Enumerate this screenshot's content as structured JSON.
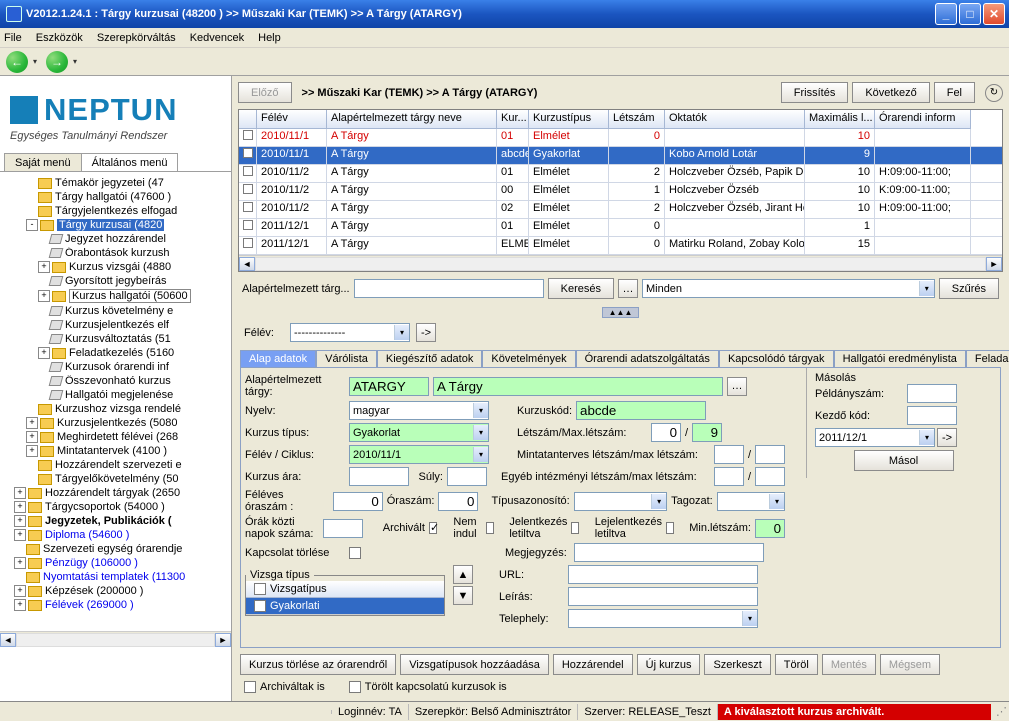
{
  "title": "V2012.1.24.1 : Tárgy kurzusai (48200  )   >> Műszaki Kar (TEMK) >> A Tárgy (ATARGY)",
  "menu": [
    "File",
    "Eszközök",
    "Szerepkörváltás",
    "Kedvencek",
    "Help"
  ],
  "neptun": {
    "brand": "NEPTUN",
    "tag": "Egységes Tanulmányi Rendszer"
  },
  "left_tabs": {
    "a": "Saját menü",
    "b": "Általános menü"
  },
  "tree": [
    {
      "ind": 2,
      "exp": "",
      "ico": "f",
      "lbl": "Témakör jegyzetei (47"
    },
    {
      "ind": 2,
      "exp": "",
      "ico": "f",
      "lbl": "Tárgy hallgatói (47600 )"
    },
    {
      "ind": 2,
      "exp": "",
      "ico": "f",
      "lbl": "Tárgyjelentkezés elfogad"
    },
    {
      "ind": 2,
      "exp": "-",
      "ico": "f",
      "lbl": "Tárgy kurzusai (4820",
      "sel": true
    },
    {
      "ind": 3,
      "exp": "",
      "ico": "j",
      "lbl": "Jegyzet hozzárendel"
    },
    {
      "ind": 3,
      "exp": "",
      "ico": "j",
      "lbl": "Órabontások kurzush"
    },
    {
      "ind": 3,
      "exp": "+",
      "ico": "f",
      "lbl": "Kurzus vizsgái (4880"
    },
    {
      "ind": 3,
      "exp": "",
      "ico": "j",
      "lbl": "Gyorsított jegybeírás"
    },
    {
      "ind": 3,
      "exp": "+",
      "ico": "f",
      "lbl": "Kurzus hallgatói (50600",
      "box": true
    },
    {
      "ind": 3,
      "exp": "",
      "ico": "j",
      "lbl": "Kurzus követelmény e"
    },
    {
      "ind": 3,
      "exp": "",
      "ico": "j",
      "lbl": "Kurzusjelentkezés elf"
    },
    {
      "ind": 3,
      "exp": "",
      "ico": "j",
      "lbl": "Kurzusváltoztatás (51"
    },
    {
      "ind": 3,
      "exp": "+",
      "ico": "f",
      "lbl": "Feladatkezelés (5160"
    },
    {
      "ind": 3,
      "exp": "",
      "ico": "j",
      "lbl": "Kurzusok órarendi inf"
    },
    {
      "ind": 3,
      "exp": "",
      "ico": "j",
      "lbl": "Összevonható kurzus"
    },
    {
      "ind": 3,
      "exp": "",
      "ico": "j",
      "lbl": "Hallgatói megjelenése"
    },
    {
      "ind": 2,
      "exp": "",
      "ico": "f",
      "lbl": "Kurzushoz vizsga rendelé"
    },
    {
      "ind": 2,
      "exp": "+",
      "ico": "f",
      "lbl": "Kurzusjelentkezés (5080"
    },
    {
      "ind": 2,
      "exp": "+",
      "ico": "f",
      "lbl": "Meghirdetett félévei (268"
    },
    {
      "ind": 2,
      "exp": "+",
      "ico": "f",
      "lbl": "Mintatantervek (4100  )"
    },
    {
      "ind": 2,
      "exp": "",
      "ico": "f",
      "lbl": "Hozzárendelt szervezeti e"
    },
    {
      "ind": 2,
      "exp": "",
      "ico": "f",
      "lbl": "Tárgyelőkövetelmény (50"
    },
    {
      "ind": 1,
      "exp": "+",
      "ico": "f",
      "lbl": "Hozzárendelt tárgyak (2650"
    },
    {
      "ind": 1,
      "exp": "+",
      "ico": "f",
      "lbl": "Tárgycsoportok (54000  )"
    },
    {
      "ind": 1,
      "exp": "+",
      "ico": "f",
      "lbl": "Jegyzetek, Publikációk (",
      "bold": true
    },
    {
      "ind": 1,
      "exp": "+",
      "ico": "f",
      "lbl": "Diploma (54600  )",
      "link": true
    },
    {
      "ind": 1,
      "exp": "",
      "ico": "f",
      "lbl": "Szervezeti egység órarendje"
    },
    {
      "ind": 1,
      "exp": "+",
      "ico": "f",
      "lbl": "Pénzügy (106000  )",
      "link": true
    },
    {
      "ind": 1,
      "exp": "",
      "ico": "f",
      "lbl": "Nyomtatási templatek (11300",
      "link": true
    },
    {
      "ind": 1,
      "exp": "+",
      "ico": "f",
      "lbl": "Képzések (200000  )"
    },
    {
      "ind": 1,
      "exp": "+",
      "ico": "f",
      "lbl": "Félévek (269000  )",
      "link": true
    }
  ],
  "hdr2_btns": {
    "prev": "Előző",
    "refresh": "Frissítés",
    "next": "Következő",
    "up": "Fel"
  },
  "breadcrumb": ">> Műszaki Kar (TEMK) >> A Tárgy (ATARGY)",
  "grid_headers": [
    "",
    "Félév",
    "Alapértelmezett tárgy neve",
    "Kur...",
    "Kurzustípus",
    "Létszám",
    "Oktatók",
    "Maximális l...",
    "Órarendi inform"
  ],
  "grid_rows": [
    {
      "c": [
        "2010/11/1",
        "A Tárgy",
        "01",
        "Elmélet",
        "0",
        "",
        "10",
        ""
      ],
      "red": true
    },
    {
      "c": [
        "2010/11/1",
        "A Tárgy",
        "abcde",
        "Gyakorlat",
        "",
        "Kobo Arnold Lotár",
        "9",
        ""
      ],
      "sel": true
    },
    {
      "c": [
        "2010/11/2",
        "A Tárgy",
        "01",
        "Elmélet",
        "2",
        "Holczveber Özséb, Papik Di",
        "10",
        "H:09:00-11:00;"
      ],
      "red": false
    },
    {
      "c": [
        "2010/11/2",
        "A Tárgy",
        "00",
        "Elmélet",
        "1",
        "Holczveber Özséb",
        "10",
        "K:09:00-11:00;"
      ],
      "red": false
    },
    {
      "c": [
        "2010/11/2",
        "A Tárgy",
        "02",
        "Elmélet",
        "2",
        "Holczveber Özséb, Jirant Ho",
        "10",
        "H:09:00-11:00;"
      ],
      "red": false
    },
    {
      "c": [
        "2011/12/1",
        "A Tárgy",
        "01",
        "Elmélet",
        "0",
        "",
        "1",
        ""
      ],
      "red": false
    },
    {
      "c": [
        "2011/12/1",
        "A Tárgy",
        "ELMEI",
        "Elmélet",
        "0",
        "Matirku Roland, Zobay Kolos",
        "15",
        ""
      ],
      "red": false
    }
  ],
  "search": {
    "label": "Alapértelmezett tárg...",
    "btn": "Keresés",
    "all": "Minden",
    "filter": "Szűrés"
  },
  "felev": {
    "label": "Félév:",
    "val": "--------------"
  },
  "tabs": [
    "Alap adatok",
    "Várólista",
    "Kiegészítő adatok",
    "Követelmények",
    "Órarendi adatszolgáltatás",
    "Kapcsolódó tárgyak",
    "Hallgatói eredménylista",
    "Felada..."
  ],
  "form": {
    "aetlbl": "Alapértelmezett tárgy:",
    "aet1": "ATARGY",
    "aet2": "A Tárgy",
    "nyelvlbl": "Nyelv:",
    "nyelv": "magyar",
    "kurzlblc": "Kurzuskód:",
    "kurzc": "abcde",
    "ktlbl": "Kurzus típus:",
    "kt": "Gyakorlat",
    "felevlbl": "Félév / Ciklus:",
    "felev": "2010/11/1",
    "lsmaxlbl": "Létszám/Max.létszám:",
    "ls": "0",
    "ls2": "9",
    "mintavlbl": "Mintatanterves létszám/max létszám:",
    "kalbl": "Kurzus ára:",
    "sulnlbl": "Súly:",
    "egybl": "Egyéb intézményi létszám/max létszám:",
    "folbl": "Féléves óraszám :",
    "fov": "0",
    "olbl": "Óraszám:",
    "ov": "0",
    "tablbl": "Típusazonosító:",
    "taglbl": "Tagozat:",
    "okbl": "Órák közti napok száma:",
    "archl": "Archivált",
    "archv": "on",
    "nembl": "Nem indul",
    "jell": "Jelentkezés letiltva",
    "lejl": "Lejelentkezés letiltva",
    "minl": "Min.létszám:",
    "minv": "0",
    "kapl": "Kapcsolat törlése",
    "megjl": "Megjegyzés:",
    "urll": "URL:",
    "leirl": "Leírás:",
    "tell": "Telephely:",
    "vizsgah": "Vizsga típus",
    "vizsga1": "Vizsgatípus",
    "vizsga2": "Gyakorlati",
    "maslbl": "Másolás",
    "peldl": "Példányszám:",
    "kezdk": "Kezdő kód:",
    "masfe": "2011/12/1",
    "masbtn": "Másol"
  },
  "btns": {
    "b1": "Kurzus törlése az órarendről",
    "b2": "Vizsgatípusok hozzáadása",
    "b3": "Hozzárendel",
    "b4": "Új kurzus",
    "b5": "Szerkeszt",
    "b6": "Töröl",
    "b7": "Mentés",
    "b8": "Mégsem"
  },
  "chks": {
    "c1": "Archiváltak is",
    "c2": "Törölt kapcsolatú kurzusok is"
  },
  "status": {
    "login": "Loginnév: TA",
    "role": "Szerepkör: Belső Adminisztrátor",
    "srv": "Szerver: RELEASE_Teszt",
    "warn": "A kiválasztott kurzus archivált."
  }
}
